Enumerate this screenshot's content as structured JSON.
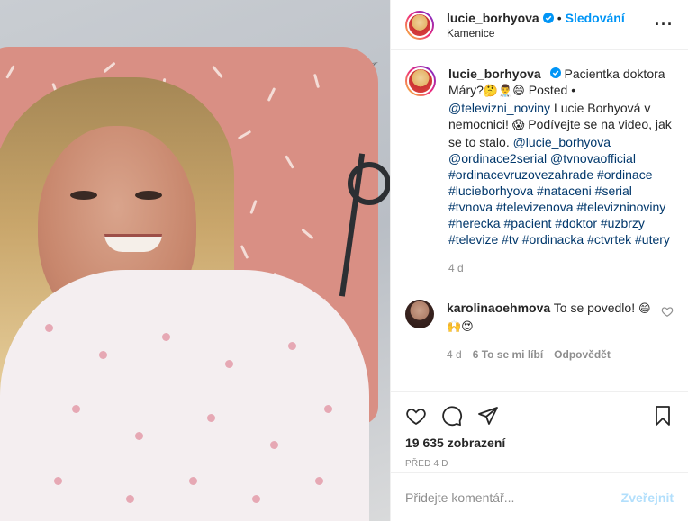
{
  "header": {
    "username": "lucie_borhyova",
    "follow_label": "Sledování",
    "location": "Kamenice",
    "more_label": "···"
  },
  "caption": {
    "username": "lucie_borhyova",
    "text_1": "Pacientka doktora Máry?",
    "emojis_1": "🤔👨‍⚕️😄",
    "text_2": "Posted •",
    "mention_1": "@televizni_noviny",
    "text_3": "Lucie Borhyová v nemocnici!",
    "emoji_2": "😱",
    "text_4": "Podívejte se na video, jak se to stalo.",
    "mentions": "@lucie_borhyova @ordinace2serial @tvnovaofficial",
    "hashtags": "#ordinacevruzovezahrade #ordinace #lucieborhyova #nataceni #serial #tvnova #televizenova #televizninoviny #herecka #pacient #doktor #uzbrzy #televize #tv #ordinacka #ctvrtek #utery",
    "age": "4 d"
  },
  "comment": {
    "username": "karolinaoehmova",
    "text": "To se povedlo!",
    "emojis": "😄🙌😍",
    "age": "4 d",
    "likes": "6 To se mi líbí",
    "reply": "Odpovědět"
  },
  "stats": {
    "views": "19 635 zobrazení",
    "posted": "PŘED 4 D"
  },
  "composer": {
    "placeholder": "Přidejte komentář...",
    "post_label": "Zveřejnit"
  },
  "colors": {
    "link": "#00376b",
    "accent": "#0095f6",
    "muted": "#8e8e8e"
  }
}
